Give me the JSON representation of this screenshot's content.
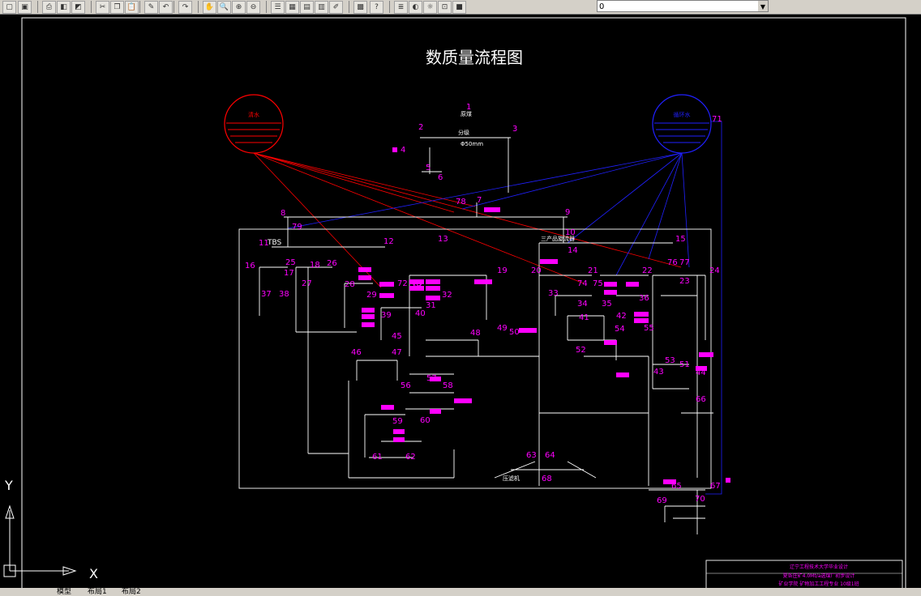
{
  "toolbar": {
    "layer_value": "0",
    "buttons": [
      {
        "name": "new-icon",
        "glyph": "▢"
      },
      {
        "name": "save-icon",
        "glyph": "▣"
      },
      {
        "name": "print-icon",
        "glyph": "⎙"
      },
      {
        "name": "preview-icon",
        "glyph": "◧"
      },
      {
        "name": "publish-icon",
        "glyph": "◩"
      },
      {
        "name": "cut-icon",
        "glyph": "✂"
      },
      {
        "name": "copy-icon",
        "glyph": "❐"
      },
      {
        "name": "paste-icon",
        "glyph": "📋"
      },
      {
        "name": "match-prop-icon",
        "glyph": "✎"
      },
      {
        "name": "undo-icon",
        "glyph": "↶"
      },
      {
        "name": "redo-icon",
        "glyph": "↷"
      },
      {
        "name": "pan-icon",
        "glyph": "✋"
      },
      {
        "name": "zoom-realtime-icon",
        "glyph": "🔍"
      },
      {
        "name": "zoom-window-icon",
        "glyph": "⊕"
      },
      {
        "name": "zoom-prev-icon",
        "glyph": "⊖"
      },
      {
        "name": "properties-icon",
        "glyph": "☰"
      },
      {
        "name": "design-center-icon",
        "glyph": "▦"
      },
      {
        "name": "tool-palette-icon",
        "glyph": "▤"
      },
      {
        "name": "sheet-set-icon",
        "glyph": "▥"
      },
      {
        "name": "markup-icon",
        "glyph": "✐"
      },
      {
        "name": "calculator-icon",
        "glyph": "▩"
      },
      {
        "name": "help-icon",
        "glyph": "?"
      },
      {
        "name": "layer-manager-icon",
        "glyph": "≣"
      },
      {
        "name": "bulb-icon",
        "glyph": "◐"
      },
      {
        "name": "sun-icon",
        "glyph": "☼"
      },
      {
        "name": "lock-icon",
        "glyph": "⊡"
      },
      {
        "name": "color-icon",
        "glyph": "■"
      }
    ]
  },
  "colors": {
    "background": "#000000",
    "line": "#ffffff",
    "label": "#ff00ff",
    "red": "#ff0000",
    "blue": "#2020ff"
  },
  "drawing": {
    "title": "数质量流程图",
    "tank_left_label": "清水",
    "tank_right_label": "循环水",
    "node_labels": [
      "1",
      "2",
      "3",
      "4",
      "5",
      "6",
      "7",
      "8",
      "9",
      "10",
      "11",
      "12",
      "13",
      "14",
      "15",
      "16",
      "17",
      "18",
      "19",
      "20",
      "21",
      "22",
      "23",
      "24",
      "25",
      "26",
      "27",
      "28",
      "29",
      "30",
      "31",
      "32",
      "33",
      "34",
      "35",
      "36",
      "37",
      "38",
      "39",
      "40",
      "41",
      "42",
      "43",
      "44",
      "45",
      "46",
      "47",
      "48",
      "49",
      "50",
      "51",
      "52",
      "53",
      "54",
      "55",
      "56",
      "57",
      "58",
      "59",
      "60",
      "61",
      "62",
      "63",
      "64",
      "65",
      "66",
      "67",
      "68",
      "69",
      "70",
      "71",
      "72",
      "73",
      "74",
      "75",
      "76",
      "77",
      "78",
      "79"
    ],
    "equipment_labels": {
      "raw_coal": "原煤",
      "classify": "分级",
      "tbs": "TBS",
      "sieve_50": "Φ50mm",
      "three_product": "三产品旋流器",
      "filter": "压滤机"
    },
    "title_block": {
      "line1": "辽宁工程技术大学毕业设计",
      "line2": "夏各庄矿4.0Mt/a选煤厂初步设计",
      "line3": "矿业学院 矿物加工工程专业 10级1班"
    }
  },
  "ucs": {
    "x_label": "X",
    "y_label": "Y"
  },
  "tabs": [
    "模型",
    "布局1",
    "布局2"
  ]
}
